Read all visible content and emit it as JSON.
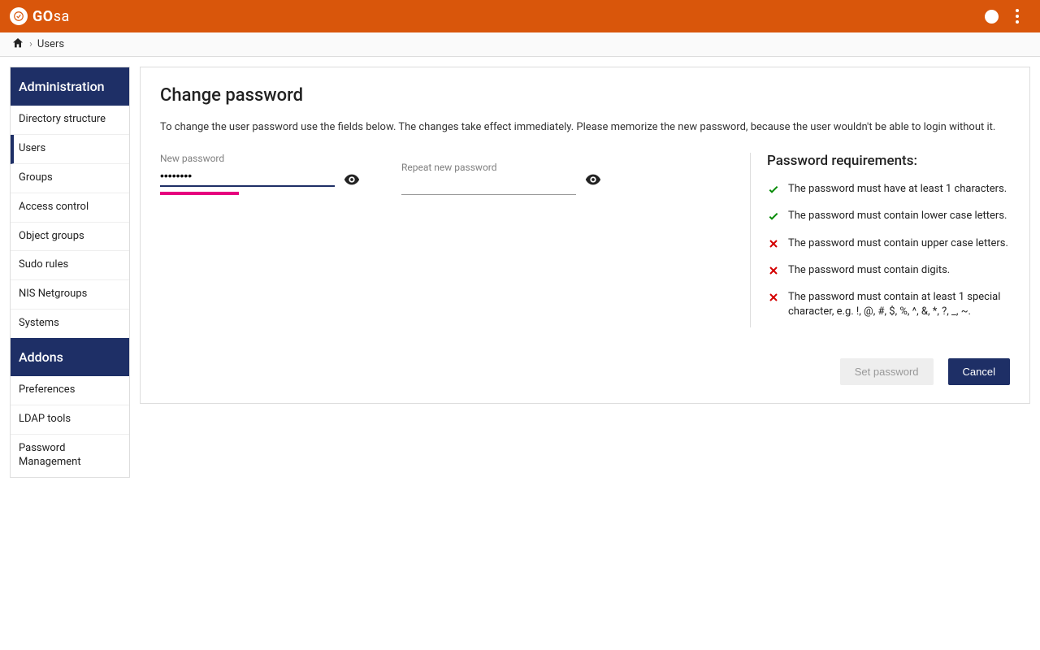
{
  "header": {
    "logo_text_bold": "GO",
    "logo_text_light": "sa"
  },
  "breadcrumb": {
    "item": "Users"
  },
  "sidebar": {
    "section1_title": "Administration",
    "section1_items": [
      "Directory structure",
      "Users",
      "Groups",
      "Access control",
      "Object groups",
      "Sudo rules",
      "NIS Netgroups",
      "Systems"
    ],
    "section1_active_index": 1,
    "section2_title": "Addons",
    "section2_items": [
      "Preferences",
      "LDAP tools",
      "Password Management"
    ]
  },
  "main": {
    "title": "Change password",
    "intro": "To change the user password use the fields below. The changes take effect immediately. Please memorize the new password, because the user wouldn't be able to login without it.",
    "new_password_label": "New password",
    "new_password_value": "••••••••",
    "repeat_password_label": "Repeat new password",
    "repeat_password_value": "",
    "requirements_title": "Password requirements:",
    "requirements": [
      {
        "ok": true,
        "text": "The password must have at least 1 characters."
      },
      {
        "ok": true,
        "text": "The password must contain lower case letters."
      },
      {
        "ok": false,
        "text": "The password must contain upper case letters."
      },
      {
        "ok": false,
        "text": "The password must contain digits."
      },
      {
        "ok": false,
        "text": "The password must contain at least 1 special character, e.g. !, @, #, $, %, ^, &, *, ?, _, ~."
      }
    ],
    "set_button": "Set password",
    "cancel_button": "Cancel"
  }
}
